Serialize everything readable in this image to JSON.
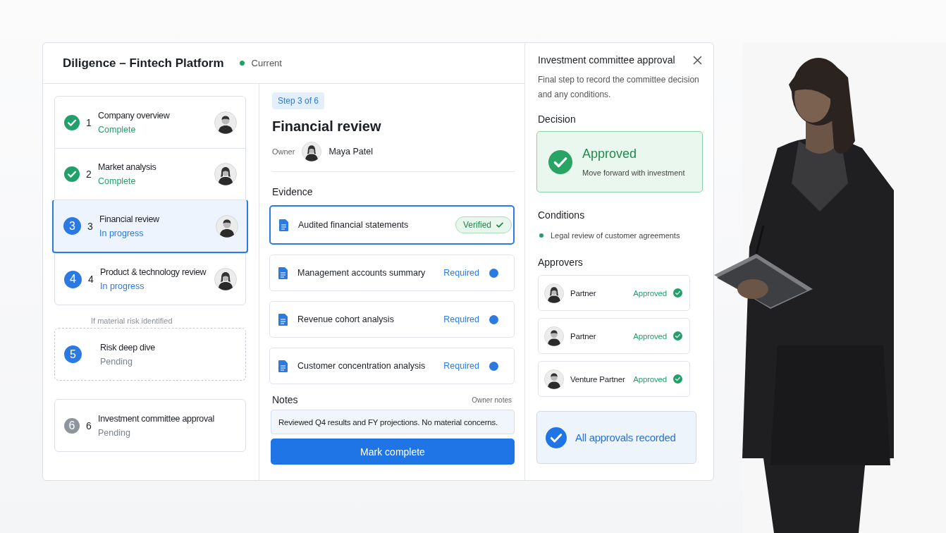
{
  "header": {
    "title": "Diligence – Fintech Platform",
    "status": {
      "label": "Current",
      "color": "#22a06b"
    }
  },
  "step_groups": [
    {
      "conditional": false,
      "steps": [
        {
          "marker": {
            "kind": "check",
            "color": "#22a06b"
          },
          "number": "1",
          "title": "Company overview",
          "status": "Complete",
          "kind": "complete",
          "selected": false,
          "has_avatar": true
        },
        {
          "marker": {
            "kind": "check",
            "color": "#22a06b"
          },
          "number": "2",
          "title": "Market analysis",
          "status": "Complete",
          "kind": "complete",
          "selected": false,
          "has_avatar": true
        },
        {
          "marker": {
            "kind": "number",
            "text": "3",
            "color": "#2a7ae2"
          },
          "number": "3",
          "title": "Financial review",
          "status": "In progress",
          "kind": "in_progress",
          "selected": true,
          "has_avatar": true
        },
        {
          "marker": {
            "kind": "number",
            "text": "4",
            "color": "#2a7ae2"
          },
          "number": "4",
          "title": "Product & technology review",
          "status": "In progress",
          "kind": "in_progress",
          "selected": false,
          "has_avatar": true
        }
      ]
    },
    {
      "conditional": true,
      "branch_label": "If material risk identified",
      "steps": [
        {
          "marker": {
            "kind": "number",
            "text": "5",
            "color": "#2a7ae2"
          },
          "title": "Risk deep dive",
          "status": "Pending",
          "kind": "pending",
          "selected": false,
          "has_avatar": false
        }
      ]
    },
    {
      "conditional": false,
      "steps": [
        {
          "marker": {
            "kind": "number",
            "text": "6",
            "color": "#8f959c"
          },
          "number": "6",
          "title": "Investment committee approval",
          "status": "Pending",
          "kind": "pending",
          "selected": false,
          "has_avatar": false
        }
      ]
    }
  ],
  "detail": {
    "step_tag": "Step 3 of 6",
    "title": "Financial review",
    "owner_label": "Owner",
    "owner_name": "Maya Patel",
    "evidence_heading": "Evidence",
    "evidence": [
      {
        "name": "Audited financial statements",
        "status": "Verified",
        "kind": "verified",
        "selected": true
      },
      {
        "name": "Management accounts summary",
        "status": "Required",
        "kind": "required",
        "selected": false
      },
      {
        "name": "Revenue cohort analysis",
        "status": "Required",
        "kind": "required",
        "selected": false
      },
      {
        "name": "Customer concentration analysis",
        "status": "Required",
        "kind": "required",
        "selected": false
      }
    ],
    "notes_label": "Notes",
    "notes_hint": "Owner notes",
    "notes_value": "Reviewed Q4 results and FY projections. No material concerns.",
    "button": "Mark complete"
  },
  "approval_panel": {
    "title": "Investment committee approval",
    "description": "Final step to record the committee decision and any conditions.",
    "decision_heading": "Decision",
    "decision": {
      "title": "Approved",
      "subtitle": "Move forward with investment"
    },
    "conditions_heading": "Conditions",
    "conditions": [
      {
        "text": "Legal review of customer agreements",
        "color": "#22a06b"
      }
    ],
    "approvers_heading": "Approvers",
    "approvers": [
      {
        "role": "Partner",
        "status": "Approved"
      },
      {
        "role": "Partner",
        "status": "Approved"
      },
      {
        "role": "Venture Partner",
        "status": "Approved"
      }
    ],
    "summary": "All approvals recorded"
  }
}
